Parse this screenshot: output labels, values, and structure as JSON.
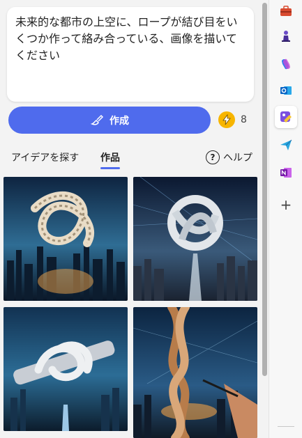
{
  "prompt": {
    "text": "未来的な都市の上空に、ロープが結び目をいくつか作って絡み合っている、画像を描いてください"
  },
  "create_button": {
    "label": "作成"
  },
  "boosts": {
    "count": "8"
  },
  "tabs": {
    "ideas": "アイデアを探す",
    "creations": "作品",
    "help": "ヘルプ",
    "help_glyph": "?"
  },
  "sidebar": {
    "items": [
      "tools-icon",
      "chess-icon",
      "copilot-icon",
      "outlook-icon",
      "designer-icon",
      "send-icon",
      "onenote-icon",
      "add-icon"
    ],
    "add_glyph": "+"
  },
  "colors": {
    "accent": "#4f6bed",
    "boost": "#f7b500"
  }
}
